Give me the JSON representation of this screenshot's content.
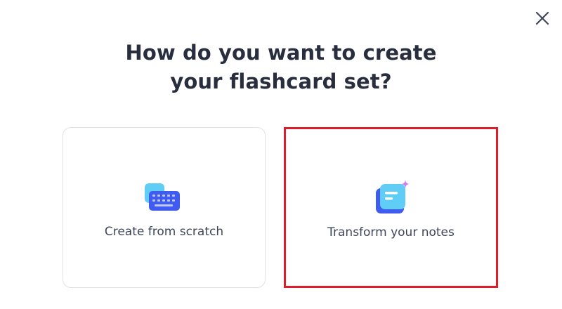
{
  "dialog": {
    "title_line1": "How do you want to create",
    "title_line2": "your flashcard set?",
    "close_icon": "close-icon"
  },
  "options": [
    {
      "label": "Create from scratch",
      "icon": "keyboard-icon"
    },
    {
      "label": "Transform your notes",
      "icon": "notes-sparkle-icon"
    }
  ],
  "colors": {
    "title": "#282e3e",
    "label": "#3f4659",
    "card_border": "#dfe2ea",
    "highlight": "#dc1d2b",
    "icon_blue": "#3f5bf0",
    "icon_light": "#5fcdf5",
    "sparkle": "#d27af2"
  }
}
